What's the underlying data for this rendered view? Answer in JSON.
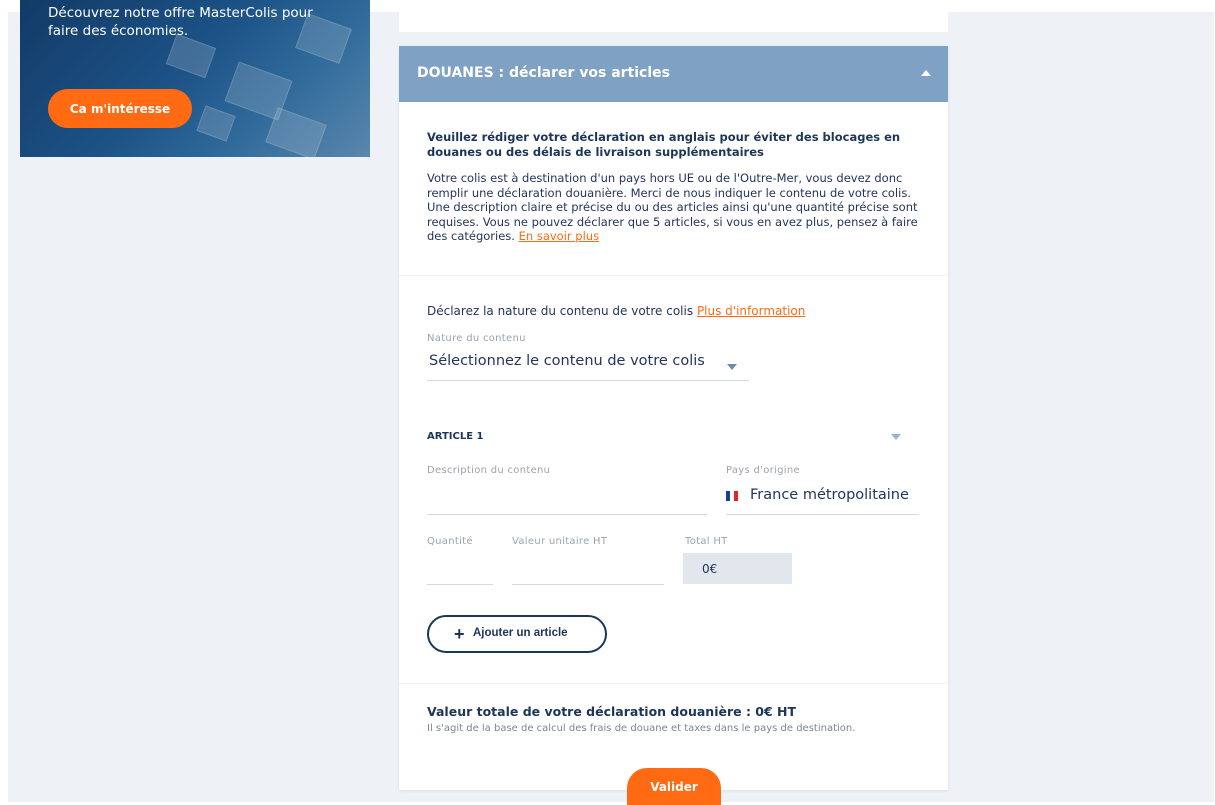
{
  "promo": {
    "text": "Découvrez notre offre MasterColis pour faire des économies.",
    "button_label": "Ca m'intéresse"
  },
  "customs": {
    "header_title": "DOUANES : déclarer vos articles",
    "warning_title": "Veuillez rédiger votre déclaration en anglais pour éviter des blocages en douanes ou des délais de livraison supplémentaires",
    "intro_text": "Votre colis est à destination d'un pays hors UE ou de l'Outre-Mer, vous devez donc remplir une déclaration douanière. Merci de nous indiquer le contenu de votre colis. Une description claire et précise du ou des articles ainsi qu'une quantité précise sont requises. Vous ne pouvez déclarer que 5 articles, si vous en avez plus, pensez à faire des catégories.",
    "intro_link": "En savoir plus",
    "nature_prompt": "Déclarez la nature du contenu de votre colis",
    "nature_link": "Plus d'information",
    "nature_label": "Nature du contenu",
    "nature_placeholder": "Sélectionnez le contenu de votre colis",
    "article": {
      "title": "ARTICLE 1",
      "description_label": "Description du contenu",
      "description_value": "",
      "country_label": "Pays d'origine",
      "country_value": "France métropolitaine",
      "quantity_label": "Quantité",
      "quantity_value": "",
      "unit_value_label": "Valeur unitaire HT",
      "unit_value": "",
      "total_label": "Total HT",
      "total_value": "0€"
    },
    "add_article_label": "Ajouter un article",
    "declaration_total": "Valeur totale de votre déclaration douanière : 0€ HT",
    "declaration_note": "Il s'agit de la base de calcul des frais de douane et taxes dans le pays de destination.",
    "validate_label": "Valider"
  },
  "colors": {
    "accent": "#ff6a13",
    "header": "#7fa1c3",
    "navy": "#1d3557"
  },
  "icons": [
    "chevron-up-icon",
    "chevron-down-icon",
    "france-flag-icon",
    "plus-icon"
  ]
}
